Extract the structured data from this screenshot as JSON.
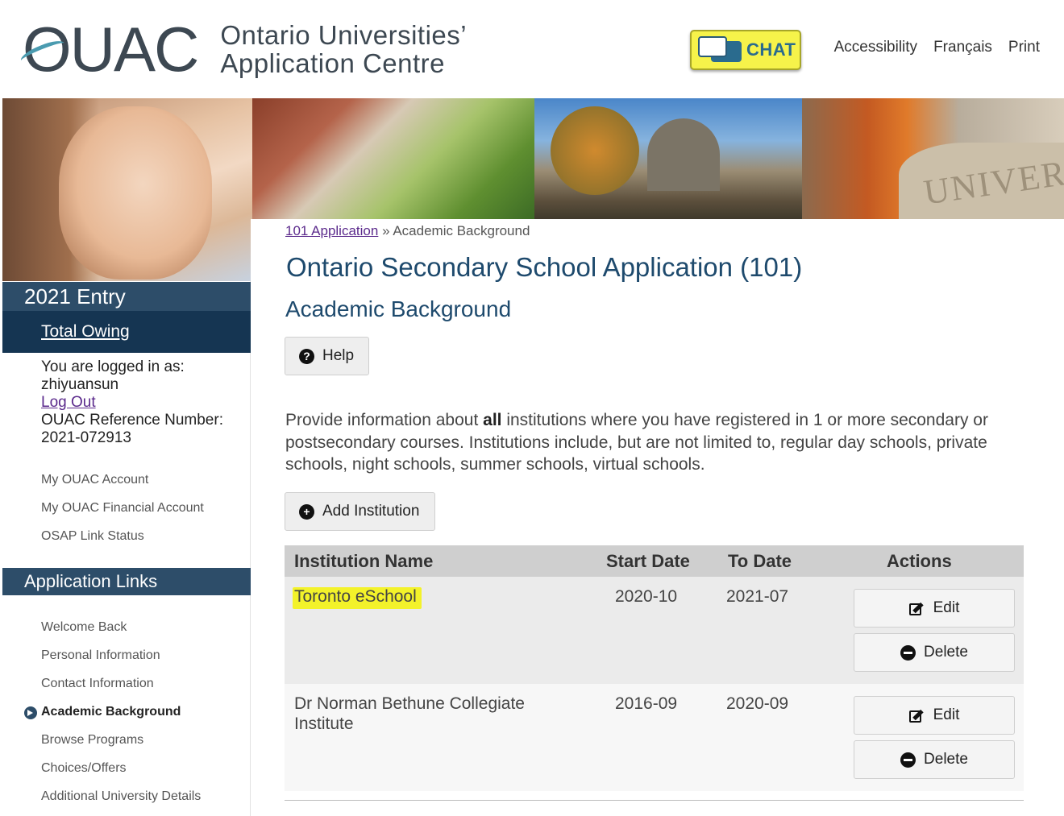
{
  "header": {
    "logo_mark": "OUAC",
    "logo_line1": "Ontario Universities’",
    "logo_line2": "Application Centre",
    "chat_label": "CHAT",
    "links": [
      "Accessibility",
      "Français",
      "Print"
    ]
  },
  "sidebar": {
    "entry_title": "2021 Entry",
    "total_owing": "Total Owing",
    "logged_in_label": "You are logged in as:",
    "username": "zhiyuansun",
    "logout": "Log Out",
    "ref_label": "OUAC Reference Number:",
    "ref_number": "2021-072913",
    "account_links": [
      "My OUAC Account",
      "My OUAC Financial Account",
      "OSAP Link Status"
    ],
    "app_links_title": "Application Links",
    "app_links": [
      "Welcome Back",
      "Personal Information",
      "Contact Information",
      "Academic Background",
      "Browse Programs",
      "Choices/Offers",
      "Additional University Details"
    ],
    "active_link": "Academic Background"
  },
  "main": {
    "breadcrumb_link": "101 Application",
    "breadcrumb_sep": "»",
    "breadcrumb_current": "Academic Background",
    "title": "Ontario Secondary School Application (101)",
    "subtitle": "Academic Background",
    "help_label": "Help",
    "intro_pre": "Provide information about ",
    "intro_bold": "all",
    "intro_post": " institutions where you have registered in 1 or more secondary or postsecondary courses. Institutions include, but are not limited to, regular day schools, private schools, night schools, summer schools, virtual schools.",
    "add_label": "Add Institution"
  },
  "table": {
    "headers": {
      "name": "Institution Name",
      "start": "Start Date",
      "to": "To Date",
      "actions": "Actions"
    },
    "rows": [
      {
        "name": "Toronto eSchool",
        "start": "2020-10",
        "to": "2021-07",
        "edit": "Edit",
        "delete": "Delete",
        "highlighted": true
      },
      {
        "name": "Dr Norman Bethune Collegiate Institute",
        "start": "2016-09",
        "to": "2020-09",
        "edit": "Edit",
        "delete": "Delete",
        "highlighted": false
      }
    ]
  },
  "colors": {
    "brand_navy": "#2d4d69",
    "brand_dark": "#153552",
    "title_blue": "#1e4a6d",
    "chat_yellow": "#f6f34a",
    "highlight": "#f3f22a",
    "link_purple": "#5b2a8c"
  },
  "icons": [
    "chat-icon",
    "question-icon",
    "plus-icon",
    "edit-icon",
    "minus-icon",
    "arrow-right-icon"
  ]
}
